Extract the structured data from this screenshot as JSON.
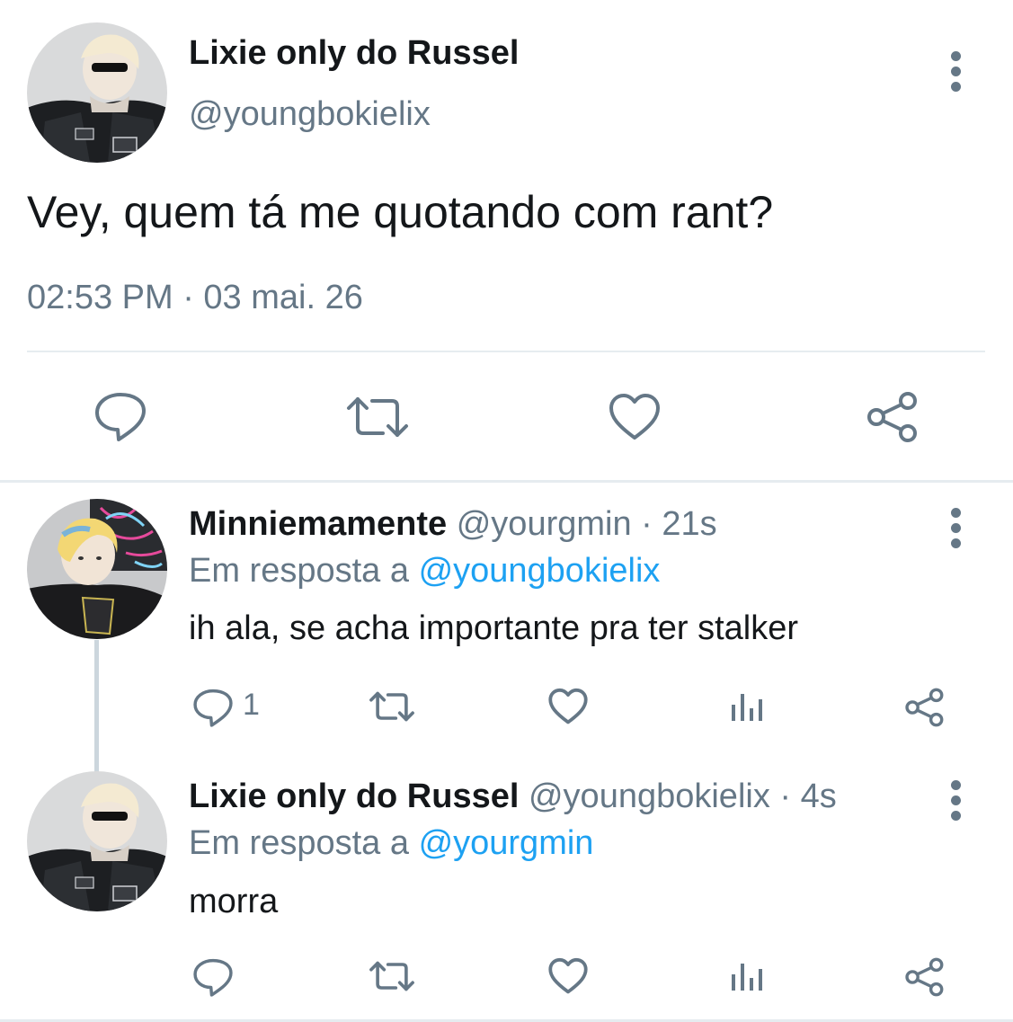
{
  "main_tweet": {
    "display_name": "Lixie only do Russel",
    "handle": "@youngbokielix",
    "text": "Vey, quem tá me quotando com rant?",
    "timestamp": "02:53 PM · 03 mai. 26",
    "actions": [
      "reply-icon",
      "retweet-icon",
      "like-icon",
      "share-icon"
    ]
  },
  "replies": [
    {
      "display_name": "Minniemamente",
      "handle_time": "@yourgmin · 21s",
      "replying_prefix": "Em resposta a ",
      "replying_to": "@youngbokielix",
      "text": "ih ala, se acha importante pra ter stalker",
      "reply_count": "1",
      "actions": [
        "reply-icon",
        "retweet-icon",
        "like-icon",
        "analytics-icon",
        "share-icon"
      ]
    },
    {
      "display_name": "Lixie only do Russel",
      "handle_time": "@youngbokielix · 4s",
      "replying_prefix": "Em resposta a ",
      "replying_to": "@yourgmin",
      "text": "morra",
      "reply_count": "",
      "actions": [
        "reply-icon",
        "retweet-icon",
        "like-icon",
        "analytics-icon",
        "share-icon"
      ]
    }
  ],
  "colors": {
    "text": "#14171a",
    "secondary": "#657786",
    "link": "#1da1f2",
    "divider": "#e6ecf0"
  }
}
